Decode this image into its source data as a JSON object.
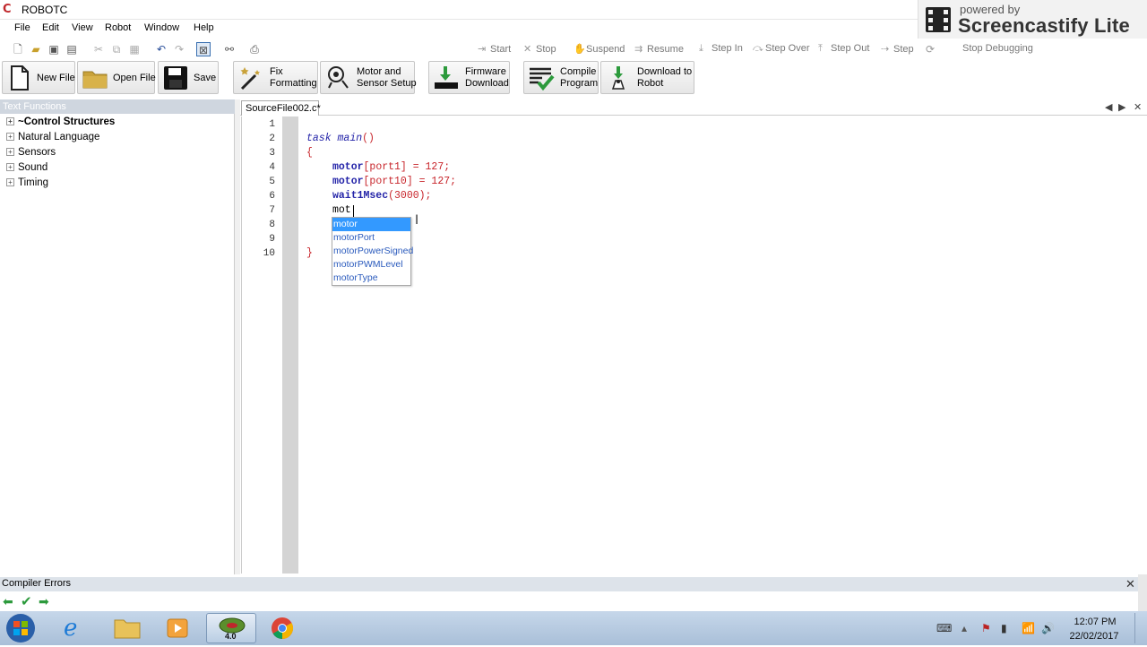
{
  "window": {
    "title": "ROBOTC",
    "logo_letter": "C"
  },
  "watermark": {
    "line1": "powered by",
    "line2": "Screencastify Lite"
  },
  "menu": [
    "File",
    "Edit",
    "View",
    "Robot",
    "Window",
    "Help"
  ],
  "debug_toolbar": {
    "start": "Start",
    "stop": "Stop",
    "suspend": "Suspend",
    "resume": "Resume",
    "step_in": "Step In",
    "step_over": "Step Over",
    "step_out": "Step Out",
    "step": "Step",
    "stop_debugging": "Stop Debugging"
  },
  "toolbar": {
    "new_file": "New File",
    "open_file": "Open File",
    "save": "Save",
    "fix_formatting_1": "Fix",
    "fix_formatting_2": "Formatting",
    "motor_setup_1": "Motor and",
    "motor_setup_2": "Sensor Setup",
    "firmware_1": "Firmware",
    "firmware_2": "Download",
    "compile_1": "Compile",
    "compile_2": "Program",
    "download_1": "Download to",
    "download_2": "Robot"
  },
  "left_panel": {
    "header": "Text Functions",
    "items": [
      {
        "label": "~Control Structures",
        "bold": true
      },
      {
        "label": "Natural Language"
      },
      {
        "label": "Sensors"
      },
      {
        "label": "Sound"
      },
      {
        "label": "Timing"
      }
    ]
  },
  "editor": {
    "tab": "SourceFile002.c*",
    "line_numbers": [
      "1",
      "2",
      "3",
      "4",
      "5",
      "6",
      "7",
      "8",
      "9",
      "10"
    ],
    "code": {
      "l2_kw": "task",
      "l2_fn": "main",
      "l2_paren": "()",
      "l3": "{",
      "l4_fn": "motor",
      "l4_rest": "[port1] = 127;",
      "l5_fn": "motor",
      "l5_rest": "[port10] = 127;",
      "l6_fn": "wait1Msec",
      "l6_rest": "(3000);",
      "l7": "mot",
      "l10": "}"
    },
    "autocomplete": [
      "motor",
      "motorPort",
      "motorPowerSigned",
      "motorPWMLevel",
      "motorType"
    ],
    "autocomplete_selected": 0
  },
  "compiler_errors": {
    "header": "Compiler Errors"
  },
  "taskbar": {
    "robotc_version": "4.0",
    "time": "12:07 PM",
    "date": "22/02/2017"
  }
}
